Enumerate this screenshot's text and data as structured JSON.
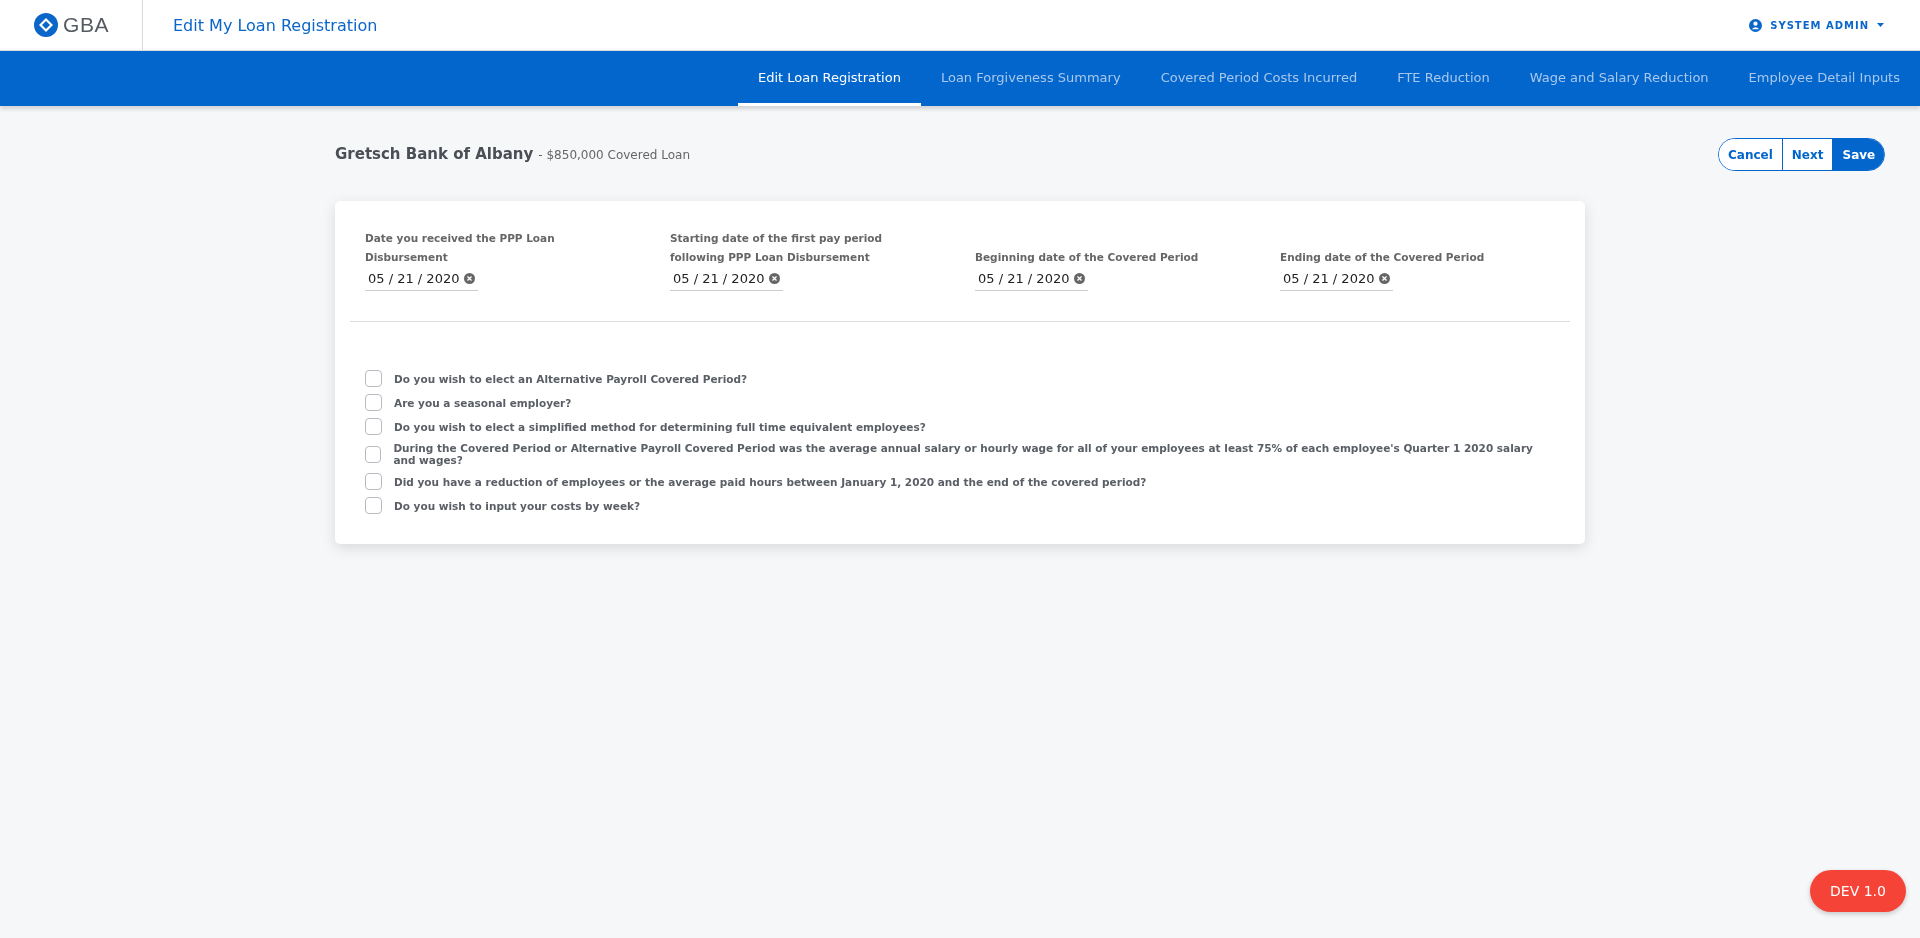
{
  "header": {
    "logo_text": "GBA",
    "title": "Edit My Loan Registration",
    "user": "SYSTEM ADMIN"
  },
  "tabs": [
    {
      "label": "Edit Loan Registration",
      "selected": true
    },
    {
      "label": "Loan Forgiveness Summary",
      "selected": false
    },
    {
      "label": "Covered Period Costs Incurred",
      "selected": false
    },
    {
      "label": "FTE Reduction",
      "selected": false
    },
    {
      "label": "Wage and Salary Reduction",
      "selected": false
    },
    {
      "label": "Employee Detail Inputs",
      "selected": false
    }
  ],
  "loan": {
    "bank": "Gretsch Bank of Albany",
    "detail": "- $850,000 Covered Loan"
  },
  "buttons": [
    "Cancel",
    "Next",
    "Save"
  ],
  "date_fields": [
    {
      "label": "Date you received the PPP Loan Disbursement",
      "value": "05 / 21 / 2020"
    },
    {
      "label": "Starting date of the first pay period following PPP Loan Disbursement",
      "value": "05 / 21 / 2020"
    },
    {
      "label": "Beginning date of the Covered Period",
      "value": "05 / 21 / 2020"
    },
    {
      "label": "Ending date of the Covered Period",
      "value": "05 / 21 / 2020"
    }
  ],
  "questions": [
    {
      "label": "Do you wish to elect an Alternative Payroll Covered Period?",
      "checked": false
    },
    {
      "label": "Are you a seasonal employer?",
      "checked": false
    },
    {
      "label": "Do you wish to elect a simplified method for determining full time equivalent employees?",
      "checked": false
    },
    {
      "label": "During the Covered Period or Alternative Payroll Covered Period was the average annual salary or hourly wage for all of your employees at least 75% of each employee's Quarter 1 2020 salary and wages?",
      "checked": false
    },
    {
      "label": "Did you have a reduction of employees or the average paid hours between January 1, 2020 and the end of the covered period?",
      "checked": false
    },
    {
      "label": "Do you wish to input your costs by week?",
      "checked": false
    }
  ],
  "version_badge": "DEV 1.0"
}
